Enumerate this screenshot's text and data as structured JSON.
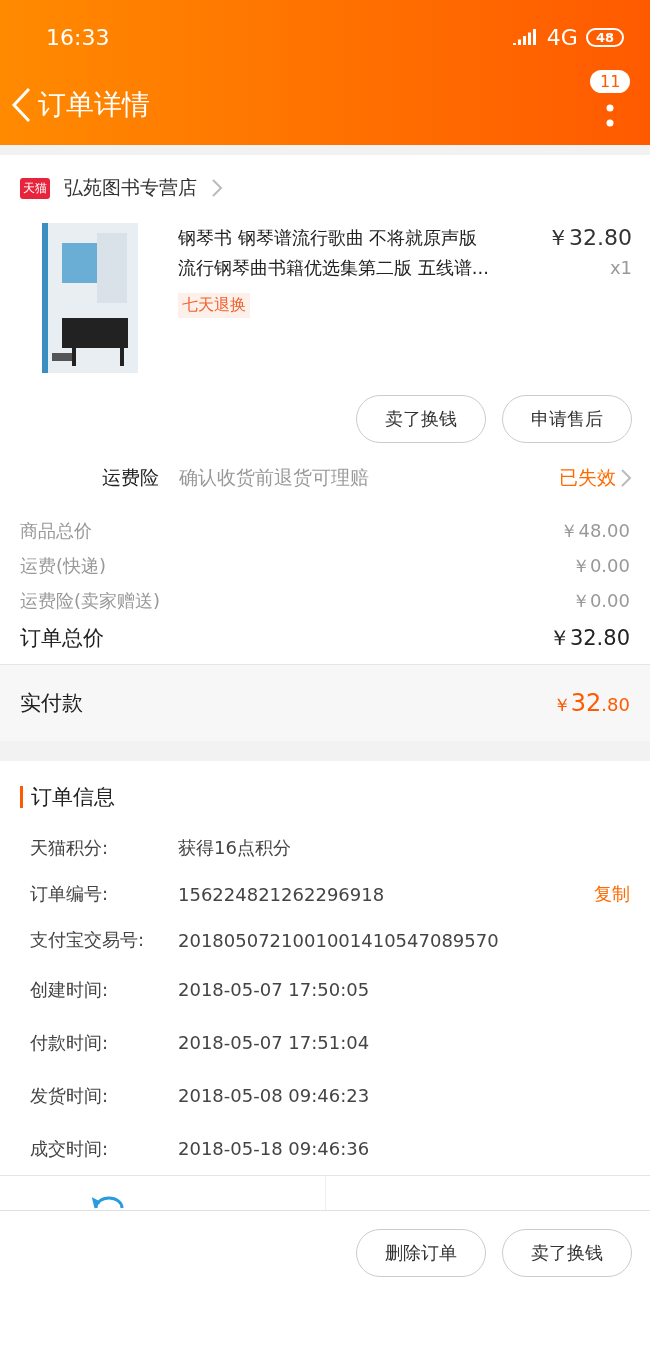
{
  "status_bar": {
    "time": "16:33",
    "network": "4G",
    "battery": "48"
  },
  "header": {
    "title": "订单详情",
    "badge": "11"
  },
  "store": {
    "badge": "天猫",
    "name": "弘苑图书专营店"
  },
  "product": {
    "title_lines": [
      "钢琴书 钢琴谱流行歌曲 不将就原声版",
      "流行钢琴曲书籍优选集第二版 五线谱..."
    ],
    "price": "￥32.80",
    "quantity": "x1",
    "tag": "七天退换"
  },
  "product_buttons": [
    "卖了换钱",
    "申请售后"
  ],
  "insurance": {
    "label": "运费险",
    "description": "确认收货前退货可理赔",
    "status": "已失效"
  },
  "price_rows": [
    {
      "label": "商品总价",
      "value": "￥48.00",
      "kind": "minor"
    },
    {
      "label": "运费(快递)",
      "value": "￥0.00",
      "kind": "minor"
    },
    {
      "label": "运费险(卖家赠送)",
      "value": "￥0.00",
      "kind": "minor"
    },
    {
      "label": "订单总价",
      "value": "￥32.80",
      "kind": "major"
    }
  ],
  "paid": {
    "label": "实付款",
    "currency": "￥",
    "integer": "32",
    "decimal": ".80"
  },
  "order_info": {
    "title": "订单信息",
    "rows": [
      {
        "label": "天猫积分:",
        "value": "获得16点积分"
      },
      {
        "label": "订单编号:",
        "value": "156224821262296918",
        "action": "复制"
      },
      {
        "label": "支付宝交易号:",
        "value": "2018050721001001410547089570"
      },
      {
        "label": "创建时间:",
        "value": "2018-05-07 17:50:05"
      },
      {
        "label": "付款时间:",
        "value": "2018-05-07 17:51:04"
      },
      {
        "label": "发货时间:",
        "value": "2018-05-08 09:46:23"
      },
      {
        "label": "成交时间:",
        "value": "2018-05-18 09:46:36"
      }
    ]
  },
  "bottom_buttons": [
    "删除订单",
    "卖了换钱"
  ]
}
